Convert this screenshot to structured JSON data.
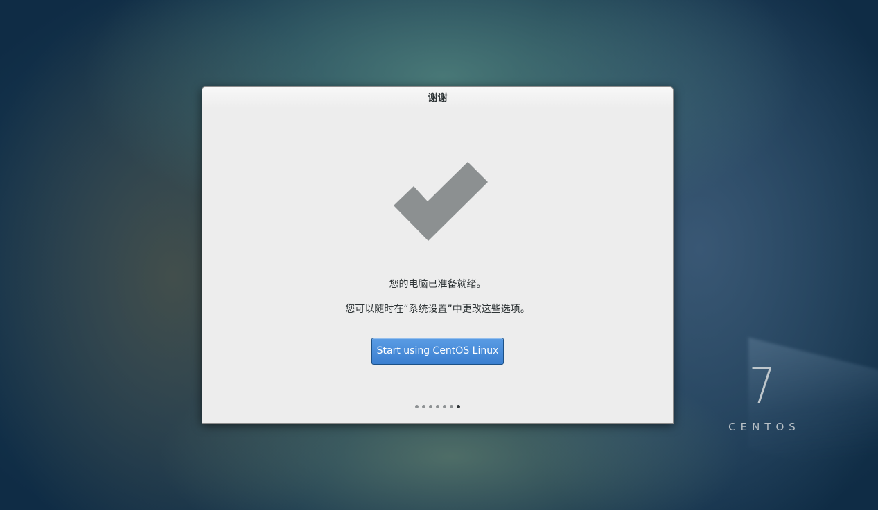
{
  "dialog": {
    "title": "谢谢",
    "message_ready": "您的电脑已准备就绪。",
    "message_settings": "您可以随时在“系统设置”中更改这些选项。",
    "start_button_label": "Start using CentOS Linux",
    "accent_color": "#4a8fdb",
    "page_indicator": {
      "total": 7,
      "current": 7
    }
  },
  "branding": {
    "version": "7",
    "name": "CENTOS"
  },
  "icons": {
    "success": "checkmark-icon"
  }
}
